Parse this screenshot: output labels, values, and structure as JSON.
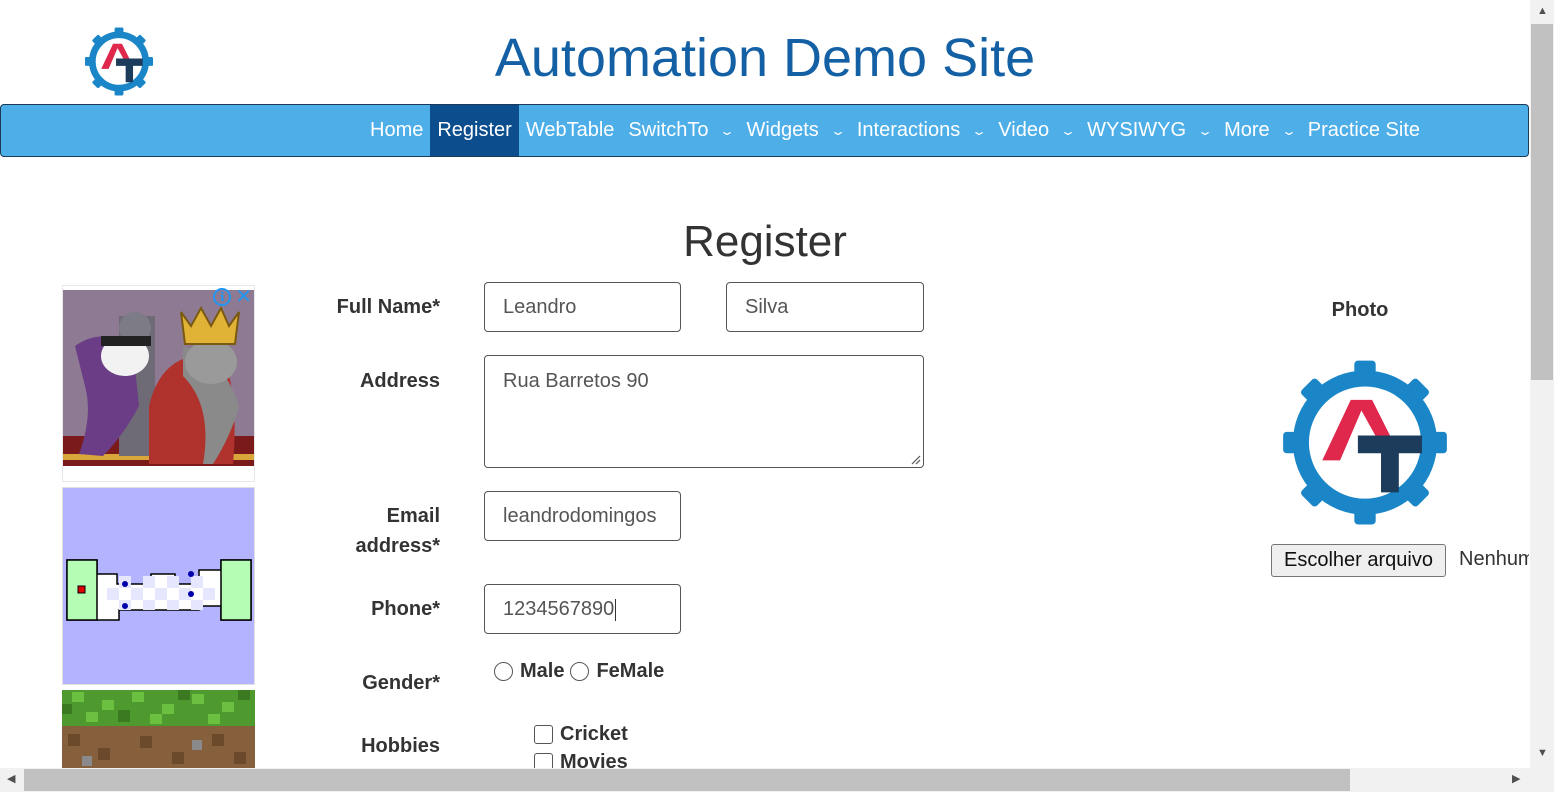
{
  "header": {
    "site_title": "Automation Demo Site",
    "logo_icon": "gear-logo-icon"
  },
  "navbar": {
    "items": [
      {
        "label": "Home",
        "dropdown": false,
        "active": false
      },
      {
        "label": "Register",
        "dropdown": false,
        "active": true
      },
      {
        "label": "WebTable",
        "dropdown": false,
        "active": false
      },
      {
        "label": "SwitchTo",
        "dropdown": true,
        "active": false
      },
      {
        "label": "Widgets",
        "dropdown": true,
        "active": false
      },
      {
        "label": "Interactions",
        "dropdown": true,
        "active": false
      },
      {
        "label": "Video",
        "dropdown": true,
        "active": false
      },
      {
        "label": "WYSIWYG",
        "dropdown": true,
        "active": false
      },
      {
        "label": "More",
        "dropdown": true,
        "active": false
      },
      {
        "label": "Practice Site",
        "dropdown": false,
        "active": false
      }
    ],
    "colors": {
      "bar": "#4eaee8",
      "active": "#0c4d8d"
    }
  },
  "page": {
    "title": "Register"
  },
  "form": {
    "full_name_label": "Full Name*",
    "first_name_value": "Leandro",
    "last_name_value": "Silva",
    "address_label": "Address",
    "address_value": "Rua Barretos 90",
    "email_label_line1": "Email",
    "email_label_line2": "address*",
    "email_value": "leandrodomingos",
    "phone_label": "Phone*",
    "phone_value": "1234567890",
    "gender_label": "Gender*",
    "gender_options": [
      "Male",
      "FeMale"
    ],
    "hobbies_label": "Hobbies",
    "hobbies_options": [
      "Cricket",
      "Movies"
    ]
  },
  "photo": {
    "label": "Photo",
    "file_button": "Escolher arquivo",
    "file_status": "Nenhum"
  },
  "ads": {
    "adchoices_icon": "info-icon",
    "close_icon": "close-icon"
  },
  "colors": {
    "title_blue": "#1460a4",
    "logo_blue": "#1a86c8",
    "logo_red": "#e0284c",
    "logo_navy": "#1d3c5c"
  }
}
